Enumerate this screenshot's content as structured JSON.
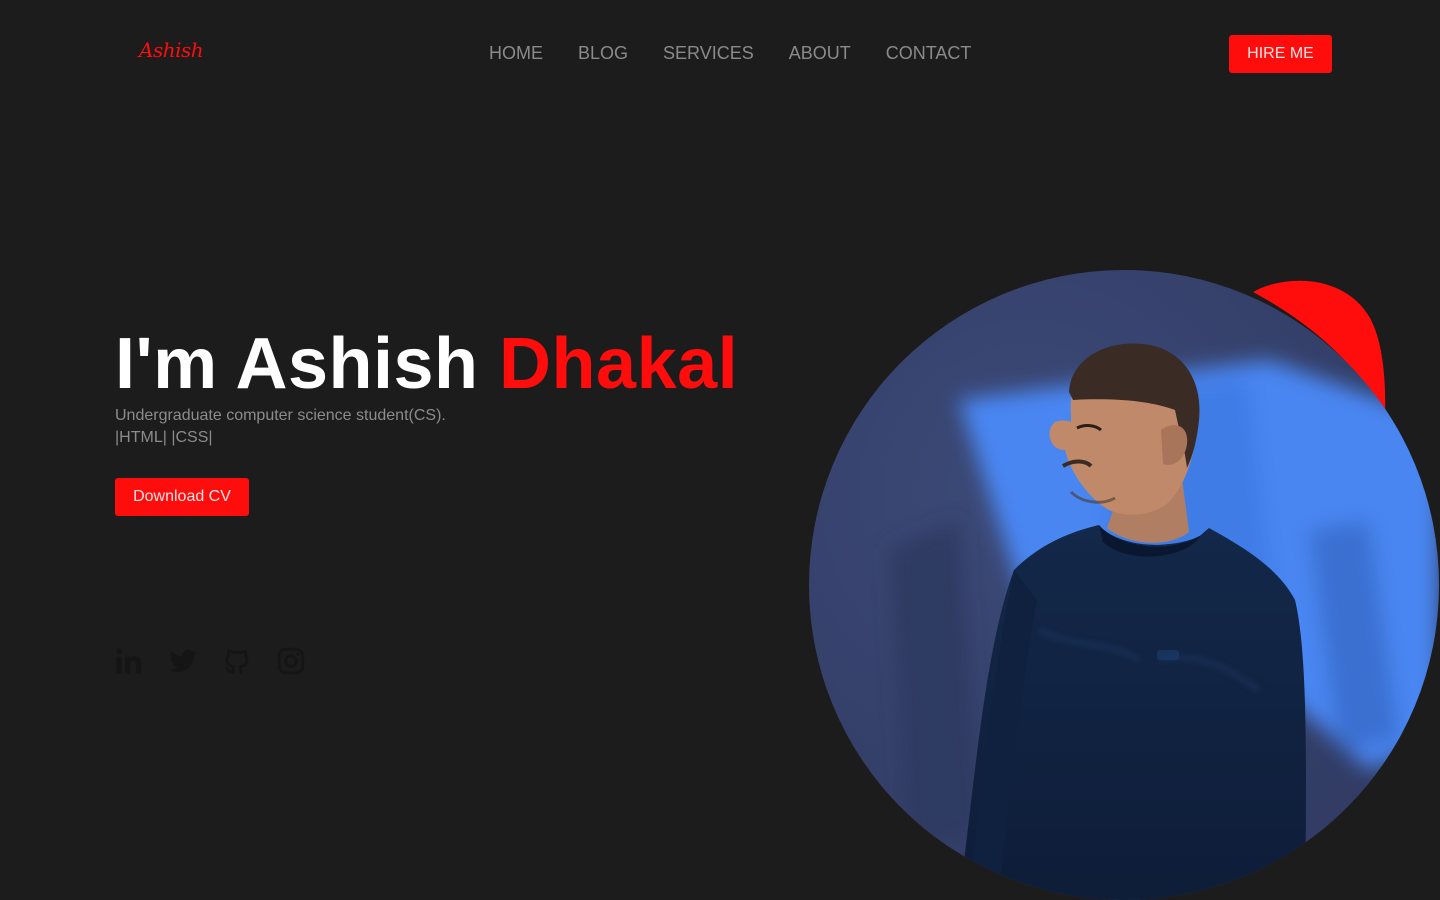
{
  "header": {
    "logo": "Ashish",
    "nav": [
      {
        "label": "HOME"
      },
      {
        "label": "BLOG"
      },
      {
        "label": "SERVICES"
      },
      {
        "label": "ABOUT"
      },
      {
        "label": "CONTACT"
      }
    ],
    "hire_label": "HIRE ME"
  },
  "hero": {
    "title_prefix": "I'm Ashish",
    "title_accent": "Dhakal",
    "subtitle_line1": "Undergraduate computer science student(CS).",
    "subtitle_line2": "|HTML| |CSS|",
    "cv_label": "Download CV"
  },
  "socials": [
    {
      "icon": "linkedin-icon"
    },
    {
      "icon": "twitter-icon"
    },
    {
      "icon": "github-icon"
    },
    {
      "icon": "instagram-icon"
    }
  ],
  "colors": {
    "background": "#1c1c1c",
    "accent": "#ff0d0d",
    "nav_text": "#8a8a8a",
    "social_icon": "#151515",
    "photo_blue": "#4a86f2",
    "photo_dark": "#343f68"
  }
}
